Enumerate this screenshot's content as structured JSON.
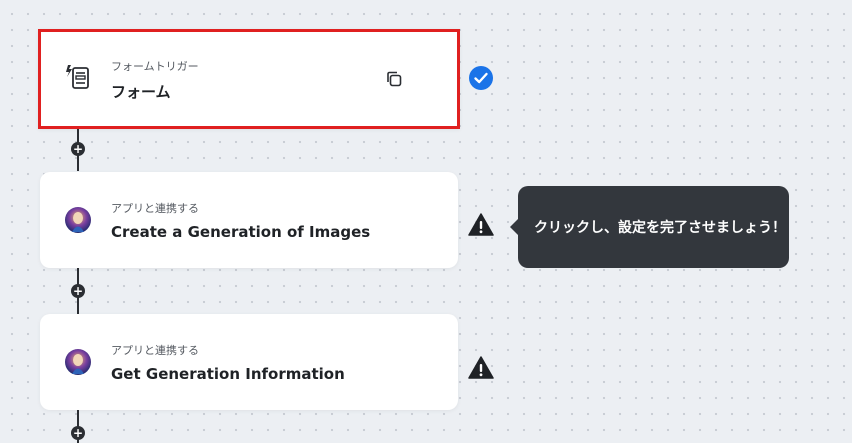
{
  "flow": {
    "steps": [
      {
        "subtitle": "フォームトリガー",
        "title": "フォーム",
        "icon": "form-trigger-icon",
        "status": "check-icon",
        "selected": true
      },
      {
        "subtitle": "アプリと連携する",
        "title": "Create a Generation of Images",
        "icon": "app-avatar-icon",
        "status": "warning-icon"
      },
      {
        "subtitle": "アプリと連携する",
        "title": "Get Generation Information",
        "icon": "app-avatar-icon",
        "status": "warning-icon"
      }
    ],
    "add_step_symbol": "+"
  },
  "tooltip": {
    "text": "クリックし、設定を完了させましょう！"
  },
  "colors": {
    "selected_border": "#e02020",
    "success": "#1a73e8",
    "connector": "#2b2e33",
    "tooltip_bg": "#33373d"
  }
}
